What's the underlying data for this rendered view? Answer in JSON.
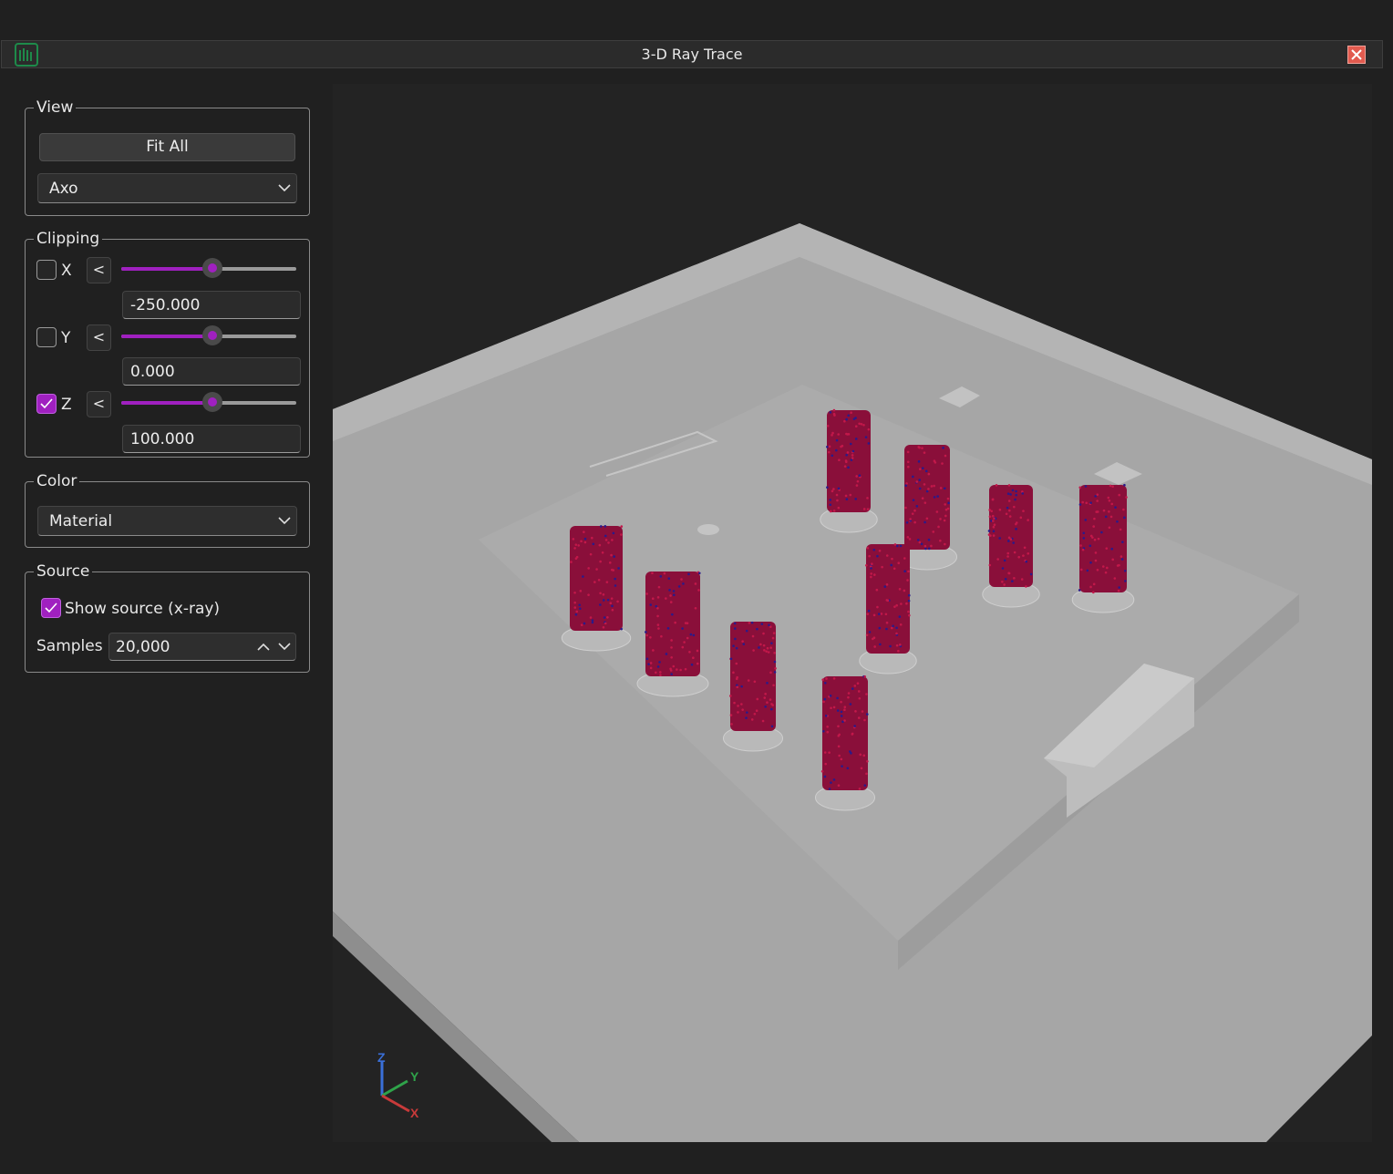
{
  "window": {
    "title": "3-D Ray Trace"
  },
  "view": {
    "legend": "View",
    "fit_all_label": "Fit All",
    "projection": "Axo"
  },
  "clipping": {
    "legend": "Clipping",
    "axes": [
      {
        "axis": "X",
        "checked": false,
        "direction": "<",
        "value": "-250.000",
        "slider_level": 0.52
      },
      {
        "axis": "Y",
        "checked": false,
        "direction": "<",
        "value": "0.000",
        "slider_level": 0.52
      },
      {
        "axis": "Z",
        "checked": true,
        "direction": "<",
        "value": "100.000",
        "slider_level": 0.52
      }
    ]
  },
  "color": {
    "legend": "Color",
    "mode": "Material"
  },
  "source": {
    "legend": "Source",
    "show_source_label": "Show source (x-ray)",
    "show_source_checked": true,
    "samples_label": "Samples",
    "samples_value": "20,000"
  },
  "axes_gizmo": {
    "x": "X",
    "y": "Y",
    "z": "Z"
  },
  "colors": {
    "accent": "#a020c0",
    "particles": "#8a0f3a",
    "particle_highlight": "#2a1a8a",
    "floor": "#a8a8a8"
  }
}
